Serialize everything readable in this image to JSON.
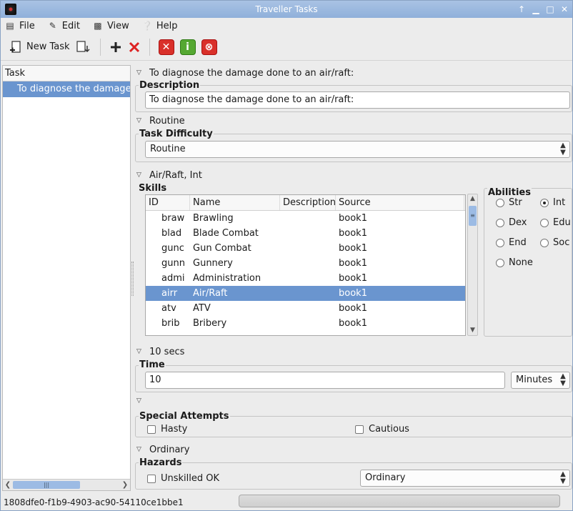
{
  "window": {
    "title": "Traveller Tasks",
    "controls": [
      "↑",
      "▁",
      "□",
      "✕"
    ]
  },
  "menu": [
    {
      "label": "File",
      "icon": "file-icon"
    },
    {
      "label": "Edit",
      "icon": "edit-icon"
    },
    {
      "label": "View",
      "icon": "view-icon"
    },
    {
      "label": "Help",
      "icon": "help-icon"
    }
  ],
  "toolbar": {
    "new_task_label": "New Task"
  },
  "task_list": {
    "header": "Task",
    "items": [
      "To diagnose the damage done to an air/raft:"
    ]
  },
  "description_section": {
    "toggle_label": "To diagnose the damage done to an air/raft:",
    "group_title": "Description",
    "value": "To diagnose the damage done to an air/raft:"
  },
  "difficulty_section": {
    "toggle_label": "Routine",
    "group_title": "Task Difficulty",
    "selected": "Routine"
  },
  "skills_section": {
    "toggle_label": "Air/Raft, Int",
    "group_title": "Skills",
    "columns": [
      "ID",
      "Name",
      "Description",
      "Source"
    ],
    "rows": [
      {
        "id": "braw",
        "name": "Brawling",
        "description": "",
        "source": "book1"
      },
      {
        "id": "blad",
        "name": "Blade Combat",
        "description": "",
        "source": "book1"
      },
      {
        "id": "gunc",
        "name": "Gun Combat",
        "description": "",
        "source": "book1"
      },
      {
        "id": "gunn",
        "name": "Gunnery",
        "description": "",
        "source": "book1"
      },
      {
        "id": "admi",
        "name": "Administration",
        "description": "",
        "source": "book1"
      },
      {
        "id": "airr",
        "name": "Air/Raft",
        "description": "",
        "source": "book1",
        "selected": true
      },
      {
        "id": "atv",
        "name": "ATV",
        "description": "",
        "source": "book1"
      },
      {
        "id": "brib",
        "name": "Bribery",
        "description": "",
        "source": "book1"
      }
    ],
    "abilities_title": "Abilities",
    "abilities": [
      {
        "label": "Str",
        "checked": false
      },
      {
        "label": "Int",
        "checked": true
      },
      {
        "label": "Dex",
        "checked": false
      },
      {
        "label": "Edu",
        "checked": false
      },
      {
        "label": "End",
        "checked": false
      },
      {
        "label": "Soc",
        "checked": false
      },
      {
        "label": "None",
        "checked": false
      }
    ]
  },
  "time_section": {
    "toggle_label": "10 secs",
    "group_title": "Time",
    "value": "10",
    "unit": "Minutes"
  },
  "special_section": {
    "toggle_label": "",
    "group_title": "Special Attempts",
    "hasty_label": "Hasty",
    "cautious_label": "Cautious"
  },
  "hazards_section": {
    "toggle_label": "Ordinary",
    "group_title": "Hazards",
    "unskilled_label": "Unskilled OK",
    "selected": "Ordinary"
  },
  "status": {
    "text": "1808dfe0-f1b9-4903-ac90-54110ce1bbe1"
  }
}
